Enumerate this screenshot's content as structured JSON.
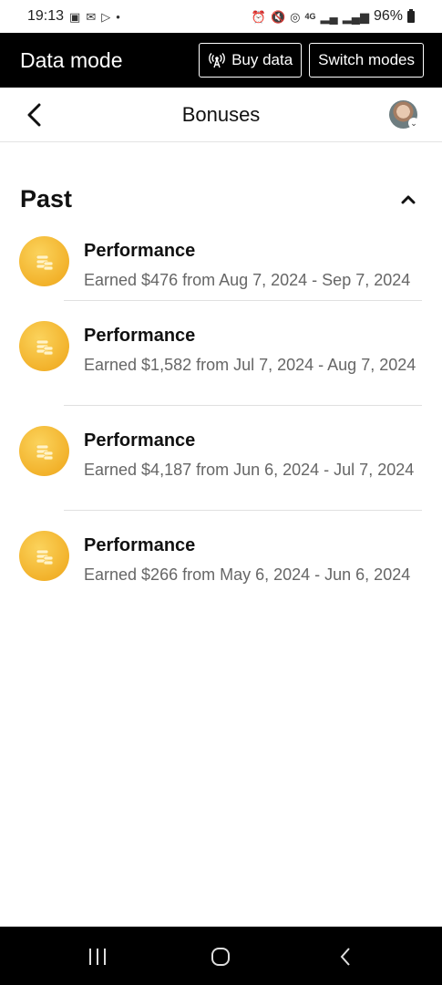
{
  "status": {
    "time": "19:13",
    "battery": "96%",
    "network": "4G"
  },
  "data_bar": {
    "title": "Data mode",
    "buy_label": "Buy data",
    "switch_label": "Switch modes"
  },
  "header": {
    "title": "Bonuses"
  },
  "section": {
    "title": "Past"
  },
  "bonuses": [
    {
      "title": "Performance",
      "desc": "Earned $476 from Aug 7, 2024 - Sep 7, 2024"
    },
    {
      "title": "Performance",
      "desc": "Earned $1,582 from Jul 7, 2024 - Aug 7, 2024"
    },
    {
      "title": "Performance",
      "desc": "Earned $4,187 from Jun 6, 2024 - Jul 7, 2024"
    },
    {
      "title": "Performance",
      "desc": "Earned $266 from May 6, 2024 - Jun 6, 2024"
    }
  ],
  "colors": {
    "coin": "#F2B22B",
    "topbar": "#000000",
    "desc_text": "#666666"
  },
  "icons": {
    "back": "back-arrow-icon",
    "collapse": "chevron-up-icon",
    "coin": "coin-stack-icon",
    "antenna": "antenna-icon"
  }
}
